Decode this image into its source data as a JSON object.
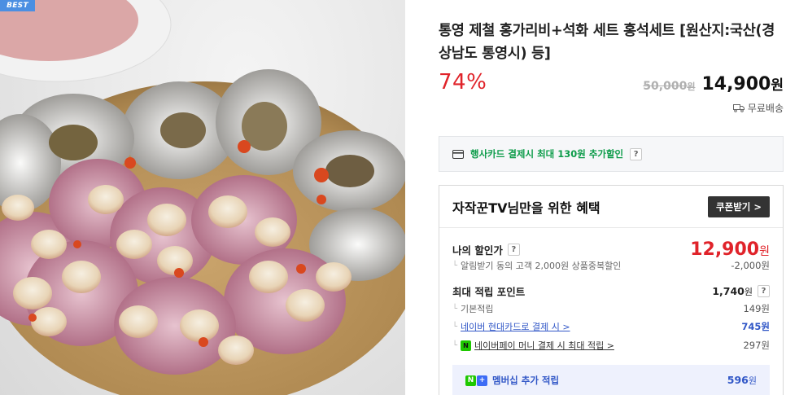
{
  "badge": {
    "best": "BEST"
  },
  "product": {
    "title": "통영 제철 홍가리비+석화 세트 홍석세트 [원산지:국산(경상남도 통영시) 등]",
    "discount_rate": "74%",
    "original_price": "50,000",
    "sale_price": "14,900",
    "currency": "원",
    "shipping": "무료배송"
  },
  "card_promo": {
    "label": "행사카드 결제시 최대 130원 추가할인",
    "help": "?"
  },
  "benefit": {
    "title": "자작꾼TV님만을 위한 혜택",
    "coupon_button": "쿠폰받기 >",
    "my_discount": {
      "label": "나의 할인가",
      "help": "?",
      "price": "12,900",
      "note": "알림받기 동의 고객 2,000원 상품중복할인",
      "note_value": "-2,000원"
    },
    "max_points": {
      "label": "최대 적립 포인트",
      "total": "1,740",
      "help": "?",
      "rows": [
        {
          "label": "기본적립",
          "value": "149원"
        },
        {
          "label": "네이버 현대카드로 결제 시 >",
          "value": "745원"
        },
        {
          "label": "네이버페이 머니 결제 시 최대 적립 >",
          "value": "297원"
        }
      ]
    },
    "membership": {
      "label": "멤버십 추가 적립",
      "value": "596"
    }
  },
  "icons": {
    "card": "credit-card-icon",
    "truck": "delivery-truck-icon",
    "npay": "N",
    "nplus_n": "N",
    "nplus_plus": "+"
  },
  "colors": {
    "discount_red": "#e0232a",
    "link_blue": "#3157c7",
    "promo_green": "#0d9c4a",
    "badge_blue": "#4b8fe2"
  }
}
